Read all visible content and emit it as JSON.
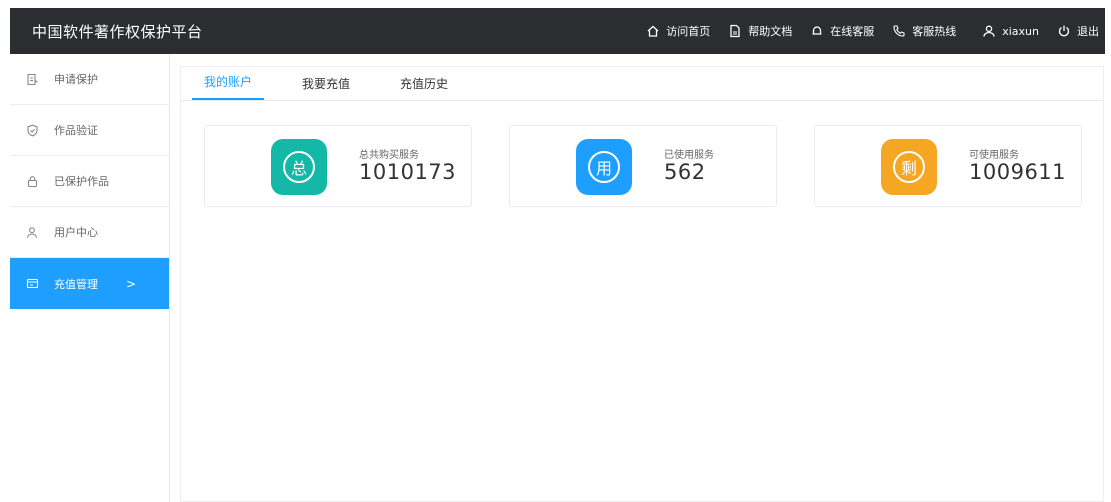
{
  "header": {
    "brand": "中国软件著作权保护平台",
    "nav": [
      {
        "label": "访问首页",
        "icon": "home-icon"
      },
      {
        "label": "帮助文档",
        "icon": "document-icon"
      },
      {
        "label": "在线客服",
        "icon": "bell-icon"
      },
      {
        "label": "客服热线",
        "icon": "phone-icon"
      },
      {
        "label": "xiaxun",
        "icon": "user-icon"
      },
      {
        "label": "退出",
        "icon": "power-icon"
      }
    ]
  },
  "sidebar": {
    "items": [
      {
        "label": "申请保护",
        "icon": "apply-icon"
      },
      {
        "label": "作品验证",
        "icon": "shield-check-icon"
      },
      {
        "label": "已保护作品",
        "icon": "lock-icon"
      },
      {
        "label": "用户中心",
        "icon": "user-icon"
      },
      {
        "label": "充值管理",
        "icon": "wallet-icon",
        "chevron": ">"
      }
    ]
  },
  "tabs": [
    {
      "label": "我的账户"
    },
    {
      "label": "我要充值"
    },
    {
      "label": "充值历史"
    }
  ],
  "cards": [
    {
      "label": "总共购买服务",
      "value": "1010173",
      "badge_char": "总",
      "color": "#14b8a6"
    },
    {
      "label": "已使用服务",
      "value": "562",
      "badge_char": "用",
      "color": "#1e9fff"
    },
    {
      "label": "可使用服务",
      "value": "1009611",
      "badge_char": "剩",
      "color": "#f5a623"
    }
  ],
  "colors": {
    "header_bg": "#2b2d30",
    "accent": "#1e9fff"
  }
}
